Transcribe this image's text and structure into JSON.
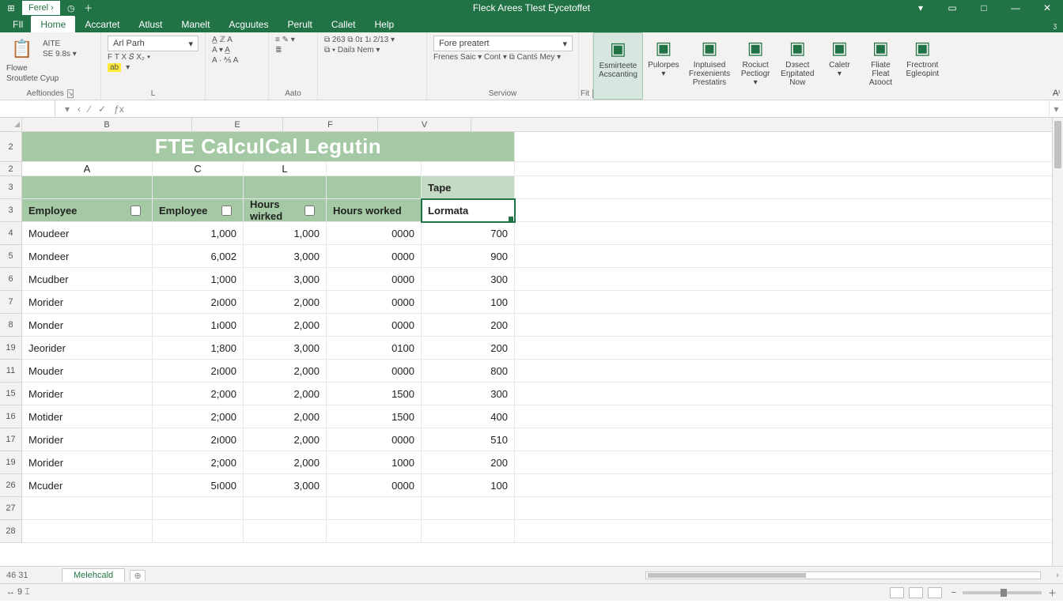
{
  "window": {
    "doc_title": "Fleck Arees Tlest Eycetoffet",
    "qat_tab": "Ferel",
    "controls": {
      "ribbon_opts": "▾",
      "min": "▭",
      "max": "□",
      "restore": "—",
      "close": "✕"
    }
  },
  "tabs": {
    "file": "FIl",
    "items": [
      "Home",
      "Accartet",
      "Atlust",
      "Manelt",
      "Acguutes",
      "Perult",
      "Callet",
      "Help"
    ],
    "active_index": 0
  },
  "ribbon": {
    "clipboard": {
      "paste": "Flowe",
      "line2": "Sroutlete Cyup",
      "label": "Aeftiondes",
      "top1": "AITE",
      "top2": "SE 9.8s ▾"
    },
    "font": {
      "name": "Arl Parh",
      "boldrow": "F  T  X  𝑆  X₂ ▾",
      "label": "L"
    },
    "font2": {
      "row1": "A̲  ℤ  A",
      "row2": "A ▾   A̲",
      "row3": "A ·  ⅍  A"
    },
    "align": {
      "row1": "≡   ✎ ▾",
      "row2": "≣",
      "label": "Aato"
    },
    "number": {
      "row1": "⧉  263    ⧉ 0ɪ 1ι 2/13 ▾",
      "row2": "⧉ ▾  Dailз Nem  ▾"
    },
    "numberfmt": {
      "box": "Fore preatert",
      "row": "Frenes Saic ▾ Cont ▾  ⧉ Cantś Mey ▾",
      "label": "Serviow"
    },
    "fit": {
      "label": "Fit"
    },
    "big_buttons": [
      {
        "l1": "Esmirteete",
        "l2": "Acscanting",
        "active": true
      },
      {
        "l1": "Pulorpes",
        "l2": "▾"
      },
      {
        "l1": "Inptuised",
        "l2": "Frexenients",
        "l3": "Prestatirs"
      },
      {
        "l1": "Rociuct",
        "l2": "Pectiogr",
        "l3": "▾"
      },
      {
        "l1": "Dзsect",
        "l2": "Eŋpitated",
        "l3": "Now"
      },
      {
        "l1": "Caletr",
        "l2": "▾"
      },
      {
        "l1": "Fliate",
        "l2": "Fleat",
        "l3": "Aɪooct"
      },
      {
        "l1": "Frectront",
        "l2": "Egleɢpint"
      }
    ]
  },
  "fxbar": {
    "namebox": "",
    "icons": [
      "▾",
      "‹",
      "∕",
      "✓",
      "ƒx"
    ],
    "formula": ""
  },
  "sheet": {
    "col_letters_top": [
      "B",
      "E",
      "F",
      "V"
    ],
    "col_letters_sub": [
      "A",
      "C",
      "L"
    ],
    "title_row_num": "2",
    "title": "FTE CalculCal Legutin",
    "subhdr_row_num": "2",
    "tape_row_num": "3",
    "tape_label": "Tape",
    "header_row_num": "3",
    "headers": [
      "Employee",
      "Employee",
      "Hours wirked",
      "Hours worked",
      "Lormata"
    ],
    "row_nums": [
      "4",
      "5",
      "6",
      "7",
      "8",
      "19",
      "11",
      "15",
      "16",
      "17",
      "19",
      "26",
      "27",
      "28"
    ],
    "rows": [
      {
        "a": "Moudeer",
        "b": "1,000",
        "c": "1,000",
        "d": "0000",
        "e": "700"
      },
      {
        "a": "Mondeer",
        "b": "6,002",
        "c": "3,000",
        "d": "0000",
        "e": "900"
      },
      {
        "a": "Mcudber",
        "b": "1;000",
        "c": "3,000",
        "d": "0000",
        "e": "300"
      },
      {
        "a": "Morider",
        "b": "2ı000",
        "c": "2,000",
        "d": "0000",
        "e": "100"
      },
      {
        "a": "Monder",
        "b": "1ı000",
        "c": "2,000",
        "d": "0000",
        "e": "200"
      },
      {
        "a": "Jeorider",
        "b": "1;800",
        "c": "3,000",
        "d": "0100",
        "e": "200"
      },
      {
        "a": "Mouder",
        "b": "2ı000",
        "c": "2,000",
        "d": "0000",
        "e": "800"
      },
      {
        "a": "Morider",
        "b": "2;000",
        "c": "2,000",
        "d": "1500",
        "e": "300"
      },
      {
        "a": "Motider",
        "b": "2;000",
        "c": "2,000",
        "d": "1500",
        "e": "400"
      },
      {
        "a": "Morider",
        "b": "2ı000",
        "c": "2,000",
        "d": "0000",
        "e": "510"
      },
      {
        "a": "Morider",
        "b": "2;000",
        "c": "2,000",
        "d": "1000",
        "e": "200"
      },
      {
        "a": "Mcuder",
        "b": "5ı000",
        "c": "3,000",
        "d": "0000",
        "e": "100"
      }
    ]
  },
  "sheettabs": {
    "stub": "46 31",
    "tab": "Melehcald",
    "add": "⊕"
  },
  "status": {
    "left": "↔ 9   ⌶"
  }
}
